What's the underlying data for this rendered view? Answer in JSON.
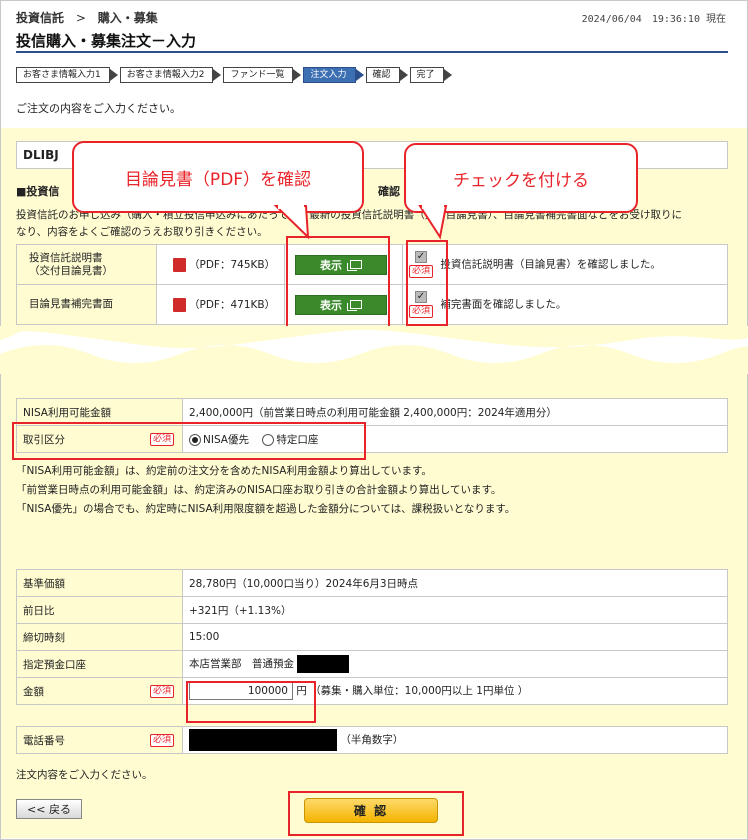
{
  "header": {
    "breadcrumb_root": "投資信託",
    "breadcrumb_sep": ">",
    "breadcrumb_current": "購入・募集",
    "datetime": "2024/06/04　19:36:10 現在",
    "title": "投信購入・募集注文－入力"
  },
  "steps": [
    {
      "label": "お客さま情報入力1"
    },
    {
      "label": "お客さま情報入力2"
    },
    {
      "label": "ファンド一覧"
    },
    {
      "label": "注文入力"
    },
    {
      "label": "確認"
    },
    {
      "label": "完了"
    }
  ],
  "intro": "ご注文の内容をご入力ください。",
  "fund_name_visible": "DLIBJ",
  "callouts": {
    "pdf": "目論見書（PDF）を確認",
    "check": "チェックを付ける"
  },
  "docs_section": {
    "heading_left": "■投資信",
    "heading_right": "確認",
    "description_line1": "投資信託のお申し込み（購入・積立投信申込みにあたっては）最新の投資信託説明書（交付目論見書）、目論見書補完書面などをお受け取りに",
    "description_line2": "なり、内容をよくご確認のうえお取り引きください。",
    "rows": [
      {
        "label_line1": "投資信託説明書",
        "label_line2": "（交付目論見書）",
        "pdf": "（PDF：745KB）",
        "button": "表示",
        "required": "必須",
        "check_text": "投資信託説明書（目論見書）を確認しました。"
      },
      {
        "label_line1": "目論見書補完書面",
        "label_line2": "",
        "pdf": "（PDF：471KB）",
        "button": "表示",
        "required": "必須",
        "check_text": "補完書面を確認しました。"
      }
    ]
  },
  "nisa": {
    "available_label": "NISA利用可能金額",
    "available_value": "2,400,000円（前営業日時点の利用可能金額 2,400,000円：2024年適用分）",
    "account_label": "取引区分",
    "required": "必須",
    "option_nisa": "NISA優先",
    "option_specific": "特定口座",
    "notes": [
      "「NISA利用可能金額」は、約定前の注文分を含めたNISA利用金額より算出しています。",
      "「前営業日時点の利用可能金額」は、約定済みのNISA口座お取り引きの合計金額より算出しています。",
      "「NISA優先」の場合でも、約定時にNISA利用限度額を超過した金額分については、課税扱いとなります。"
    ]
  },
  "order": {
    "base_price_label": "基準価額",
    "base_price_value": "28,780円（10,000口当り）2024年6月3日時点",
    "change_label": "前日比",
    "change_value": "+321円（+1.13%）",
    "cutoff_label": "締切時刻",
    "cutoff_value": "15:00",
    "account_label": "指定預金口座",
    "account_value": "本店営業部　普通預金",
    "amount_label": "金額",
    "required": "必須",
    "amount_value": "100000",
    "amount_unit": "円",
    "amount_note": "（募集・購入単位：10,000円以上 1円単位 ）",
    "phone_label": "電話番号",
    "phone_note": "（半角数字）"
  },
  "footer": {
    "instruction": "注文内容をご入力ください。",
    "back_button": "<< 戻る",
    "confirm_button": "確 認"
  },
  "colors": {
    "accent_red": "#e8242a",
    "yellow_bg": "#fffcd2",
    "show_button_green": "#3a8a2c",
    "active_step_blue": "#3d6fb3",
    "confirm_button_gold": "#f4b400"
  }
}
